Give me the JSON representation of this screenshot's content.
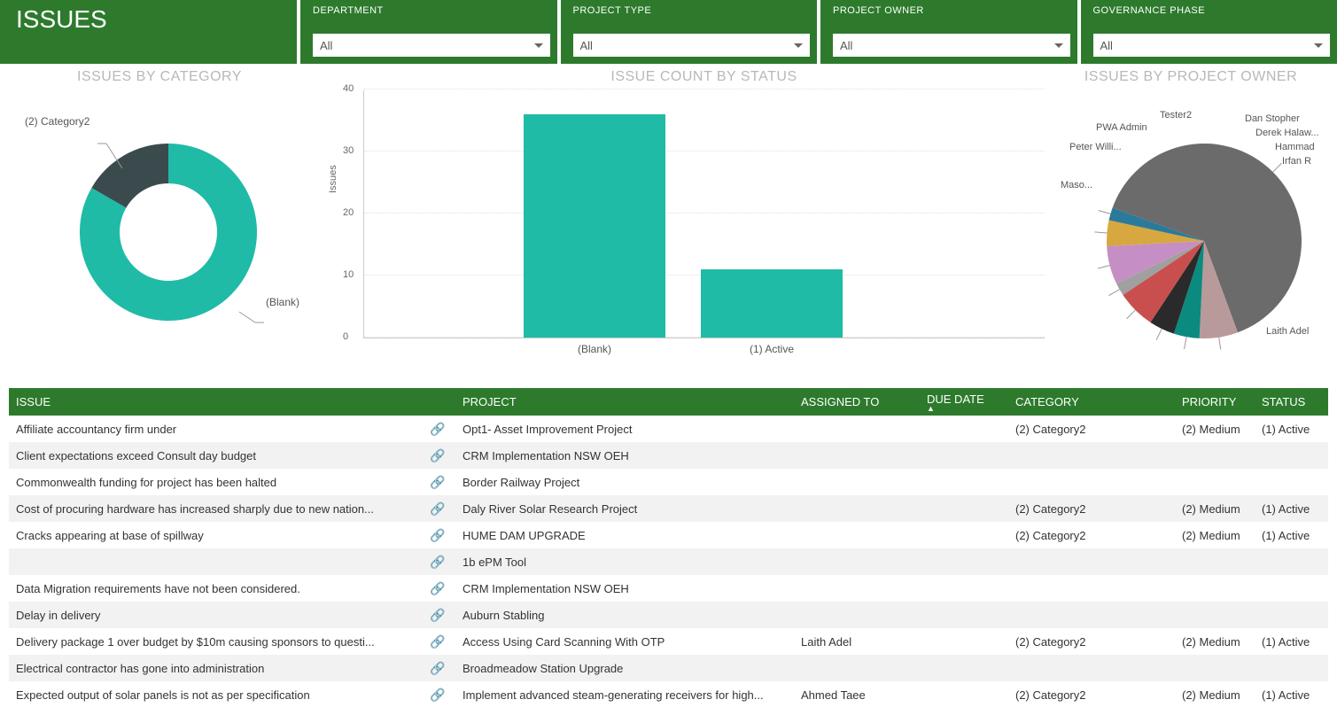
{
  "header": {
    "title": "ISSUES",
    "filters": [
      {
        "label": "DEPARTMENT",
        "value": "All"
      },
      {
        "label": "PROJECT TYPE",
        "value": "All"
      },
      {
        "label": "PROJECT OWNER",
        "value": "All"
      },
      {
        "label": "GOVERNANCE PHASE",
        "value": "All"
      }
    ]
  },
  "chart_data": [
    {
      "type": "pie",
      "title": "ISSUES BY CATEGORY",
      "subtype": "donut",
      "categories": [
        "(2) Category2",
        "(Blank)"
      ],
      "values": [
        12,
        36
      ],
      "colors": [
        "#3b4a4d",
        "#1fbba6"
      ]
    },
    {
      "type": "bar",
      "title": "ISSUE COUNT BY STATUS",
      "categories": [
        "(Blank)",
        "(1) Active"
      ],
      "values": [
        36,
        11
      ],
      "ylabel": "Issues",
      "xlabel": "",
      "ylim": [
        0,
        40
      ],
      "y_ticks": [
        0,
        10,
        20,
        30,
        40
      ],
      "bar_color": "#1fbba6"
    },
    {
      "type": "pie",
      "title": "ISSUES BY PROJECT OWNER",
      "categories": [
        "Laith Adel",
        "Maso...",
        "Peter Willi...",
        "PWA Admin",
        "Tester2",
        "Dan Stopher",
        "Derek Halaw...",
        "Hammad",
        "Irfan R"
      ],
      "values": [
        30,
        3,
        2,
        2,
        3,
        1,
        3,
        2,
        1
      ],
      "colors": [
        "#6b6b6b",
        "#b89a9a",
        "#0b8a7f",
        "#2a2a2a",
        "#c94f4f",
        "#a0a0a0",
        "#c58fc5",
        "#d6a83f",
        "#2c7a99"
      ]
    }
  ],
  "charts": {
    "donut": {
      "title": "ISSUES BY CATEGORY",
      "label1": "(2) Category2",
      "label2": "(Blank)"
    },
    "bar": {
      "title": "ISSUE COUNT BY STATUS",
      "ylabel": "Issues"
    },
    "pie": {
      "title": "ISSUES BY PROJECT OWNER"
    }
  },
  "table": {
    "headers": {
      "issue": "ISSUE",
      "project": "PROJECT",
      "assigned": "ASSIGNED TO",
      "due": "DUE DATE",
      "category": "CATEGORY",
      "priority": "PRIORITY",
      "status": "STATUS"
    },
    "rows": [
      {
        "issue": "Affiliate accountancy firm under",
        "project": "Opt1- Asset Improvement Project",
        "assigned": "",
        "due": "",
        "category": "(2) Category2",
        "priority": "(2) Medium",
        "status": "(1) Active"
      },
      {
        "issue": "Client expectations exceed Consult day budget",
        "project": "CRM Implementation NSW OEH",
        "assigned": "",
        "due": "",
        "category": "",
        "priority": "",
        "status": ""
      },
      {
        "issue": "Commonwealth funding for project has been halted",
        "project": "Border Railway Project",
        "assigned": "",
        "due": "",
        "category": "",
        "priority": "",
        "status": ""
      },
      {
        "issue": "Cost of procuring hardware has increased sharply due to new nation...",
        "project": "Daly River Solar Research Project",
        "assigned": "",
        "due": "",
        "category": "(2) Category2",
        "priority": "(2) Medium",
        "status": "(1) Active"
      },
      {
        "issue": "Cracks appearing at base of spillway",
        "project": "HUME DAM UPGRADE",
        "assigned": "",
        "due": "",
        "category": "(2) Category2",
        "priority": "(2) Medium",
        "status": "(1) Active"
      },
      {
        "issue": "",
        "project": "1b ePM Tool",
        "assigned": "",
        "due": "",
        "category": "",
        "priority": "",
        "status": ""
      },
      {
        "issue": "Data Migration requirements have not been considered.",
        "project": "CRM Implementation NSW OEH",
        "assigned": "",
        "due": "",
        "category": "",
        "priority": "",
        "status": ""
      },
      {
        "issue": "Delay in delivery",
        "project": "Auburn Stabling",
        "assigned": "",
        "due": "",
        "category": "",
        "priority": "",
        "status": ""
      },
      {
        "issue": "Delivery package 1 over budget by $10m causing sponsors to questi...",
        "project": "        Access Using Card Scanning With OTP",
        "assigned": "Laith Adel",
        "due": "",
        "category": "(2) Category2",
        "priority": "(2) Medium",
        "status": "(1) Active"
      },
      {
        "issue": "Electrical contractor has gone into administration",
        "project": "Broadmeadow Station Upgrade",
        "assigned": "",
        "due": "",
        "category": "",
        "priority": "",
        "status": ""
      },
      {
        "issue": "Expected output of solar panels is not as per specification",
        "project": "Implement advanced steam-generating receivers for high...",
        "assigned": "Ahmed Taee",
        "due": "",
        "category": "(2) Category2",
        "priority": "(2) Medium",
        "status": "(1) Active"
      }
    ]
  }
}
